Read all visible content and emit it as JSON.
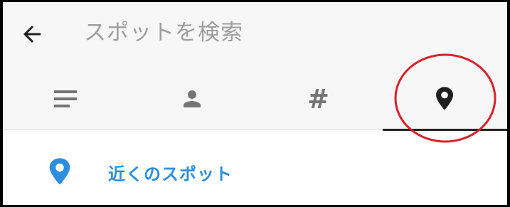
{
  "search": {
    "placeholder": "スポットを検索",
    "value": ""
  },
  "tabs": [
    {
      "icon": "list-icon",
      "selected": false
    },
    {
      "icon": "person-icon",
      "selected": false
    },
    {
      "icon": "hashtag-icon",
      "label": "#",
      "selected": false
    },
    {
      "icon": "location-pin-icon",
      "selected": true
    }
  ],
  "results": {
    "nearby_label": "近くのスポット",
    "nearby_icon": "location-pin-icon"
  },
  "colors": {
    "header_bg": "#f7f7f7",
    "icon_gray": "#757575",
    "accent_blue": "#2d8ee0",
    "annotation_red": "#d9212b",
    "indicator": "#222222"
  }
}
